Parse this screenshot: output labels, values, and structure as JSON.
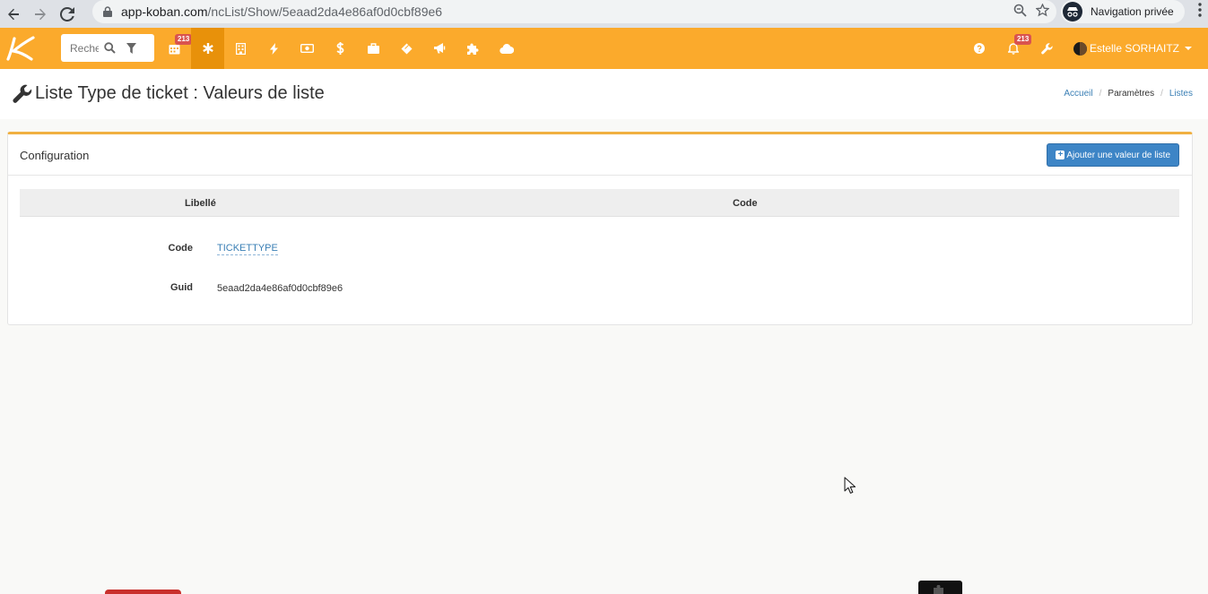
{
  "browser": {
    "url_host": "app-koban.com",
    "url_path": "/ncList/Show/5eaad2da4e86af0d0cbf89e6",
    "profile_label": "Navigation privée"
  },
  "appnav": {
    "search_placeholder": "Rechercher",
    "calendar_badge": "213",
    "notifications_badge": "213",
    "user_name": "Estelle SORHAITZ",
    "accent_color": "#fbaa2c",
    "active_color": "#e8910a",
    "icons": [
      "calendar-icon",
      "asterisk-icon",
      "building-icon",
      "bolt-icon",
      "money-icon",
      "dollar-icon",
      "briefcase-icon",
      "ticket-icon",
      "megaphone-icon",
      "puzzle-icon",
      "cloud-icon"
    ]
  },
  "page": {
    "title": "Liste Type de ticket : Valeurs de liste",
    "breadcrumb": {
      "home": "Accueil",
      "settings": "Paramètres",
      "lists": "Listes"
    }
  },
  "panel": {
    "title": "Configuration",
    "add_button": "Ajouter une valeur de liste",
    "columns": {
      "libelle": "Libellé",
      "code": "Code"
    },
    "fields": {
      "code_label": "Code",
      "code_value": "TICKETTYPE",
      "guid_label": "Guid",
      "guid_value": "5eaad2da4e86af0d0cbf89e6"
    }
  }
}
